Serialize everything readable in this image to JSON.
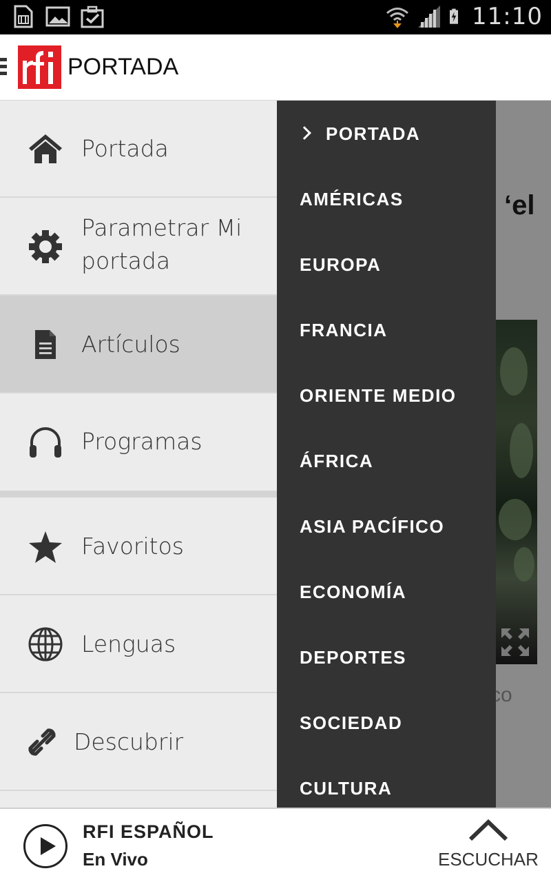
{
  "status_bar": {
    "time": "11:10",
    "left_icons": [
      "sim-card-icon",
      "image-icon",
      "clipboard-check-icon"
    ],
    "right_icons": [
      "wifi-icon",
      "signal-icon",
      "battery-charging-icon"
    ]
  },
  "app_bar": {
    "title": "PORTADA",
    "logo_text": "rfi",
    "brand_color": "#e11f26"
  },
  "drawer": {
    "items": [
      {
        "label": "Portada",
        "icon": "home-icon",
        "active": false
      },
      {
        "label": "Parametrar Mi portada",
        "icon": "gear-icon",
        "active": false
      },
      {
        "label": "Artículos",
        "icon": "document-icon",
        "active": true
      },
      {
        "label": "Programas",
        "icon": "headphones-icon",
        "active": false
      },
      {
        "label": "Favoritos",
        "icon": "star-icon",
        "active": false
      },
      {
        "label": "Lenguas",
        "icon": "globe-icon",
        "active": false
      },
      {
        "label": "Descubrir",
        "icon": "link-icon",
        "active": false
      }
    ]
  },
  "sections": {
    "items": [
      {
        "label": "PORTADA",
        "selected": true
      },
      {
        "label": "AMÉRICAS"
      },
      {
        "label": "EUROPA"
      },
      {
        "label": "FRANCIA"
      },
      {
        "label": "ORIENTE MEDIO"
      },
      {
        "label": "ÁFRICA"
      },
      {
        "label": "ASIA PACÍFICO"
      },
      {
        "label": "ECONOMÍA"
      },
      {
        "label": "DEPORTES"
      },
      {
        "label": "SOCIEDAD"
      },
      {
        "label": "CULTURA"
      }
    ]
  },
  "background": {
    "headline_fragment": "‘el",
    "text_fragment": "co"
  },
  "player": {
    "station": "RFI ESPAÑOL",
    "status": "En Vivo",
    "listen_label": "ESCUCHAR"
  }
}
